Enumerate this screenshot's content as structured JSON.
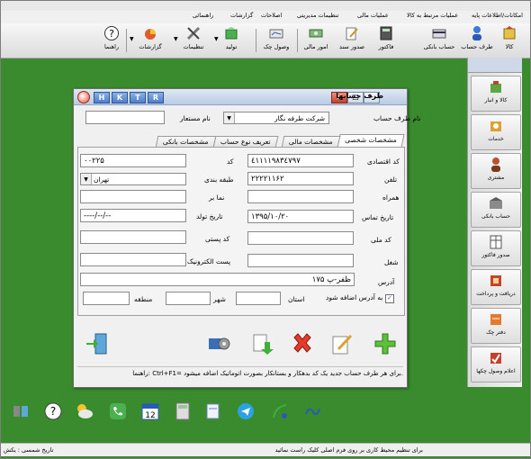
{
  "menu": [
    "امکانات/اطلاعات پایه",
    "عملیات مرتبط به کالا",
    "عملیات مالی",
    "تنظیمات مدیریتی",
    "اصلاحات",
    "گزارشات",
    "راهنمائی"
  ],
  "toolbar": {
    "kala": "کالا",
    "taraf_hesab": "طرف حساب",
    "hesab_banki": "حساب بانکی",
    "factor": "فاکتور",
    "sodor_sanad": "صدور سند",
    "omor_mali": "امور مالی",
    "vosol_chek": "وصول چک",
    "tolid": "تولید",
    "tanzimat": "تنظیمات",
    "gozareshat": "گزارشات",
    "rahnama": "راهنما"
  },
  "sidebar": {
    "items": [
      "کالا و انبار",
      "خدمات",
      "مشتری",
      "حساب بانکی",
      "صدور فاکتور",
      "دریافت و پرداخت",
      "دفتر چک",
      "اعلام وصول چکها"
    ]
  },
  "dialog": {
    "title": "طرف حسابها",
    "hotkeys": [
      "H",
      "K",
      "T",
      "R"
    ],
    "type_label": "نام طرف حساب",
    "type_value": "شرکت طرفه نگار",
    "alias_label": "نام مستعار",
    "alias_value": "",
    "tabs": [
      "مشخصات شخصی",
      "مشخصات مالی",
      "تعریف نوع حساب",
      "مشخصات بانکی"
    ],
    "fields": {
      "economic_code_label": "کد اقتصادی",
      "economic_code": "٤١١١١٩٨٣٤٧٩٧",
      "code_label": "کد",
      "code": "۰۰۲۲۵",
      "phone_label": "تلفن",
      "phone": "۲۲۲۲۱۱۶۲",
      "category_label": "طبقه بندی",
      "category": "تهران",
      "mobile_label": "همراه",
      "mobile": "",
      "fax_label": "نما بر",
      "fax": "",
      "contact_date_label": "تاریخ تماس",
      "contact_date": "۱۳۹۵/۱۰/۲۰",
      "birth_label": "تاریخ تولد",
      "birth": "----/--/--",
      "national_label": "کد ملی",
      "national": "",
      "postal_label": "کد پستی",
      "postal": "",
      "job_label": "شغل",
      "job": "",
      "email_label": "پست الکترونیک",
      "email": "",
      "address_label": "آدرس",
      "address": "ظفر-پ ۱۷۵",
      "add_to_address_label": "به آدرس اضافه شود",
      "add_to_address_checked": "✓",
      "province_label": "استان",
      "province": "",
      "city_label": "شهر",
      "city": "",
      "region_label": "منطقه",
      "region": ""
    },
    "hint": "راهنما: Ctrl+F1=   برای هر طرف حساب جدید یک کد بدهکار و بستانکار بصورت اتوماتیک اضافه میشود."
  },
  "status": {
    "left": "تاریخ شمسی : یکش",
    "right": "برای تنظیم محیط کاری بر روی فرم اصلی کلیک راست نمائید"
  },
  "colors": {
    "desktop": "#3a8a2e",
    "dialog_title": "#b9cbe4",
    "hotkey_blue": "#4f7fc9"
  }
}
